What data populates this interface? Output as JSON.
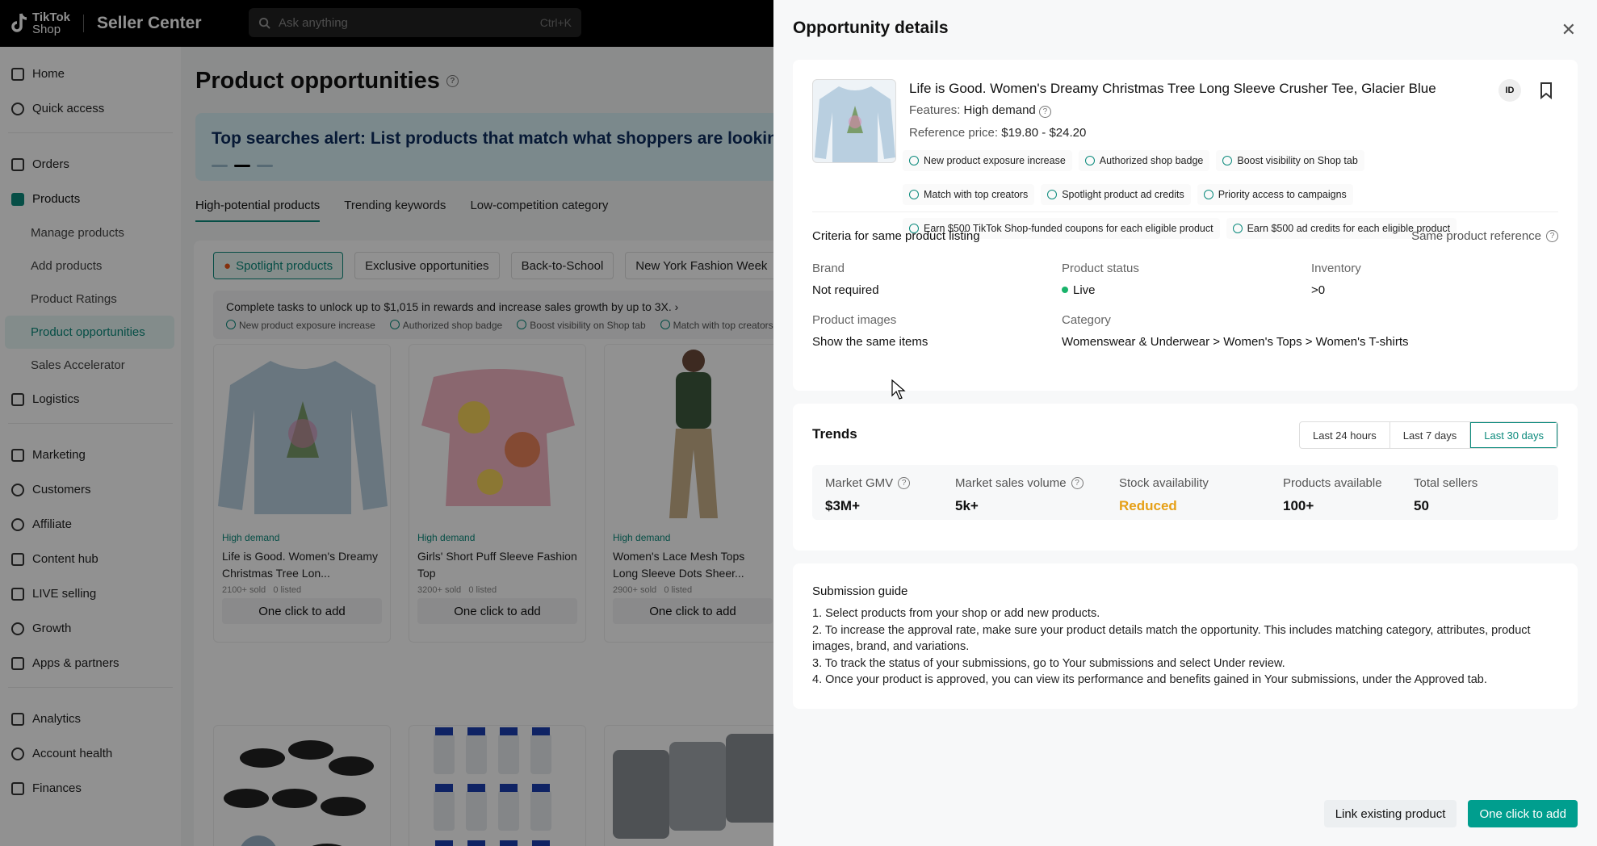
{
  "app": {
    "logo_line1": "TikTok",
    "logo_line2": "Shop",
    "brand": "Seller Center",
    "search_placeholder": "Ask anything",
    "search_shortcut": "Ctrl+K"
  },
  "sidebar": {
    "items": [
      {
        "label": "Home",
        "icon": "home-icon"
      },
      {
        "label": "Quick access",
        "icon": "quick-access-icon"
      },
      {
        "label": "Orders",
        "icon": "orders-icon"
      },
      {
        "label": "Products",
        "icon": "products-icon"
      },
      {
        "label": "Logistics",
        "icon": "truck-icon"
      },
      {
        "label": "Marketing",
        "icon": "megaphone-icon"
      },
      {
        "label": "Customers",
        "icon": "customers-icon"
      },
      {
        "label": "Affiliate",
        "icon": "affiliate-icon"
      },
      {
        "label": "Content hub",
        "icon": "content-icon"
      },
      {
        "label": "LIVE selling",
        "icon": "live-icon"
      },
      {
        "label": "Growth",
        "icon": "growth-icon"
      },
      {
        "label": "Apps & partners",
        "icon": "apps-icon"
      },
      {
        "label": "Analytics",
        "icon": "analytics-icon"
      },
      {
        "label": "Account health",
        "icon": "shield-icon"
      },
      {
        "label": "Finances",
        "icon": "finances-icon"
      }
    ],
    "product_sub": [
      "Manage products",
      "Add products",
      "Product Ratings",
      "Product opportunities",
      "Sales Accelerator"
    ]
  },
  "main": {
    "title": "Product opportunities",
    "banner": "Top searches alert: List products that match what shoppers are looking for",
    "tabs": [
      "High-potential products",
      "Trending keywords",
      "Low-competition category"
    ],
    "chips": [
      "Spotlight products",
      "Exclusive opportunities",
      "Back-to-School",
      "New York Fashion Week"
    ],
    "task_title": "Complete tasks to unlock up to $1,015 in rewards and increase sales growth by up to 3X.",
    "task_tags": [
      "New product exposure increase",
      "Authorized shop badge",
      "Boost visibility on Shop tab",
      "Match with top creators"
    ],
    "cards": [
      {
        "demand": "High demand",
        "title": "Life is Good. Women's Dreamy Christmas Tree Lon...",
        "sold": "2100+ sold",
        "listed": "0 listed",
        "btn": "One click to add"
      },
      {
        "demand": "High demand",
        "title": "Girls' Short Puff Sleeve Fashion Top",
        "sold": "3200+ sold",
        "listed": "0 listed",
        "btn": "One click to add"
      },
      {
        "demand": "High demand",
        "title": "Women's Lace Mesh Tops Long Sleeve Dots Sheer...",
        "sold": "2900+ sold",
        "listed": "0 listed",
        "btn": "One click to add"
      }
    ]
  },
  "drawer": {
    "title": "Opportunity details",
    "product": {
      "title": "Life is Good. Women's Dreamy Christmas Tree Long Sleeve Crusher Tee, Glacier Blue",
      "features_label": "Features:",
      "features_value": "High demand",
      "price_label": "Reference price:",
      "price_value": "$19.80 - $24.20",
      "id_badge": "ID"
    },
    "benefits": [
      "New product exposure increase",
      "Authorized shop badge",
      "Boost visibility on Shop tab",
      "Match with top creators",
      "Spotlight product ad credits",
      "Priority access to campaigns",
      "Earn $500 TikTok Shop-funded coupons for each eligible product",
      "Earn $500 ad credits for each eligible product"
    ],
    "criteria": {
      "title": "Criteria for same product listing",
      "ref_link": "Same product reference",
      "brand_k": "Brand",
      "brand_v": "Not required",
      "status_k": "Product status",
      "status_v": "Live",
      "inv_k": "Inventory",
      "inv_v": ">0",
      "images_k": "Product images",
      "images_v": "Show the same items",
      "cat_k": "Category",
      "cat_v": "Womenswear & Underwear > Women's Tops > Women's T-shirts"
    },
    "trends": {
      "title": "Trends",
      "ranges": [
        "Last 24 hours",
        "Last 7 days",
        "Last 30 days"
      ],
      "metrics": [
        {
          "k": "Market GMV",
          "v": "$3M+"
        },
        {
          "k": "Market sales volume",
          "v": "5k+"
        },
        {
          "k": "Stock availability",
          "v": "Reduced"
        },
        {
          "k": "Products available",
          "v": "100+"
        },
        {
          "k": "Total sellers",
          "v": "50"
        }
      ]
    },
    "guide": {
      "title": "Submission guide",
      "steps": [
        "1. Select products from your shop or add new products.",
        "2. To increase the approval rate, make sure your product details match the opportunity. This includes matching category, attributes, product images, brand, and variations.",
        "3. To track the status of your submissions, go to Your submissions and select Under review.",
        "4. Once your product is approved, you can view its performance and benefits gained in Your submissions, under the Approved tab."
      ]
    },
    "footer": {
      "link_btn": "Link existing product",
      "add_btn": "One click to add"
    }
  },
  "colors": {
    "accent": "#009e8e",
    "stock_reduced": "#e6a017",
    "live": "#19b36b"
  }
}
